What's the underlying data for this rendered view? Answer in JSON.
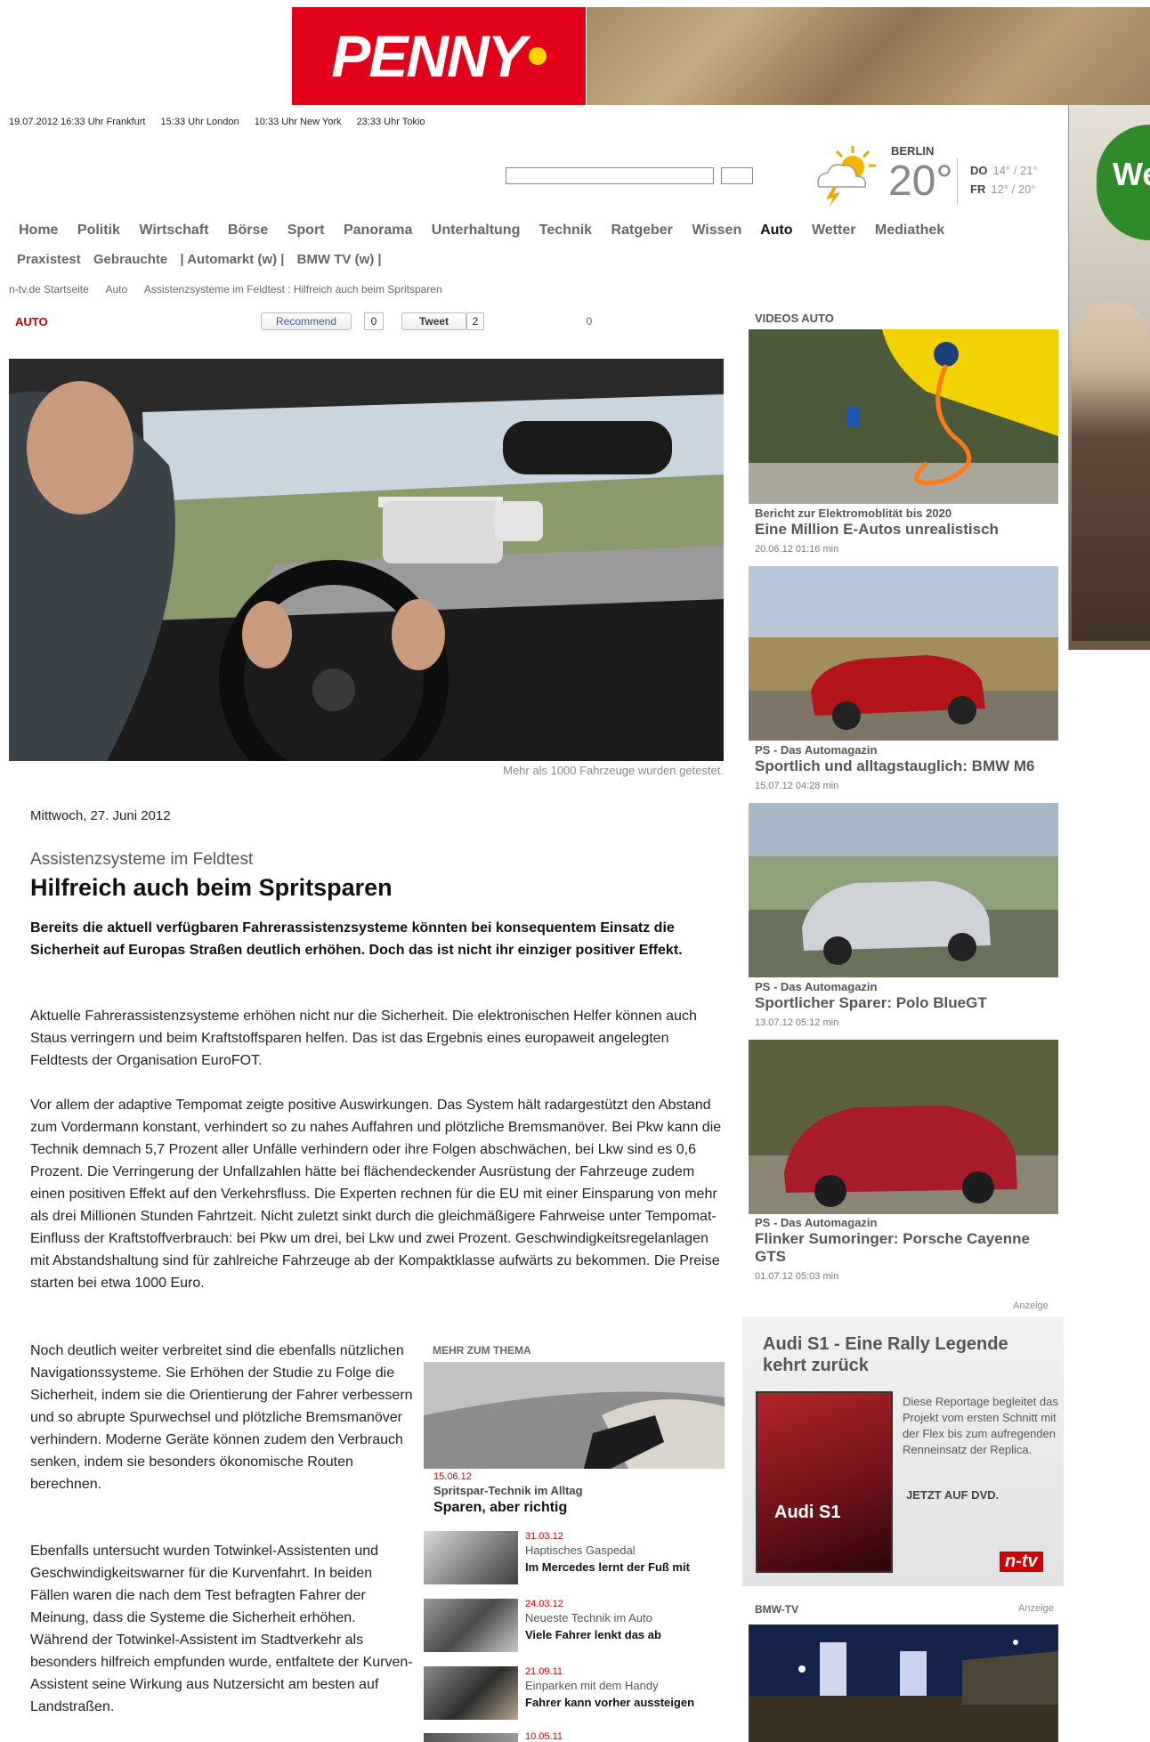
{
  "banner": {
    "logo_text": "PENNY"
  },
  "skyscraper": {
    "text": "We d"
  },
  "clock": [
    "19.07.2012 16:33 Uhr Frankfurt",
    "15:33 Uhr London",
    "10:33 Uhr New York",
    "23:33 Uhr Tokio"
  ],
  "weather": {
    "city": "BERLIN",
    "temp": "20°",
    "days": [
      {
        "day": "DO",
        "range": "14° / 21°"
      },
      {
        "day": "FR",
        "range": "12° / 20°"
      }
    ]
  },
  "nav": {
    "items": [
      "Home",
      "Politik",
      "Wirtschaft",
      "Börse",
      "Sport",
      "Panorama",
      "Unterhaltung",
      "Technik",
      "Ratgeber",
      "Wissen",
      "Auto",
      "Wetter",
      "Mediathek"
    ],
    "active": "Auto",
    "sub": [
      "Praxistest",
      "Gebrauchte",
      "| Automarkt (w) |",
      "BMW TV (w) |"
    ]
  },
  "breadcrumb": [
    "n-tv.de Startseite",
    "Auto",
    "Assistenzsysteme im Feldtest : Hilfreich auch beim Spritsparen"
  ],
  "section": "AUTO",
  "social": {
    "recommend": "Recommend",
    "recommend_count": "0",
    "tweet": "Tweet",
    "tweet_count": "2",
    "plus_count": "0"
  },
  "article": {
    "caption": "Mehr als 1000 Fahrzeuge wurden getestet.",
    "date": "Mittwoch, 27. Juni 2012",
    "kicker": "Assistenzsysteme im Feldtest",
    "headline": "Hilfreich auch beim Spritsparen",
    "lead": "Bereits die aktuell verfügbaren Fahrerassistenzsysteme könnten bei konsequentem Einsatz die Sicherheit auf Europas Straßen deutlich erhöhen. Doch das ist nicht ihr einziger positiver Effekt.",
    "paragraphs": [
      "Aktuelle Fahrerassistenzsysteme erhöhen nicht nur die Sicherheit. Die elektronischen Helfer können auch Staus verringern und beim Kraftstoffsparen helfen. Das ist das Ergebnis eines europaweit angelegten Feldtests der Organisation EuroFOT.",
      "Vor allem der adaptive Tempomat zeigte positive Auswirkungen. Das System hält radargestützt den Abstand zum Vordermann konstant, verhindert so zu nahes Auffahren und plötzliche Bremsmanöver. Bei Pkw kann die Technik demnach 5,7 Prozent aller Unfälle verhindern oder ihre Folgen abschwächen, bei Lkw sind es 0,6 Prozent. Die Verringerung der Unfallzahlen hätte bei flächendeckender Ausrüstung der Fahrzeuge zudem einen positiven Effekt auf den Verkehrsfluss. Die Experten rechnen für die EU mit einer Einsparung von mehr als drei Millionen Stunden Fahrtzeit. Nicht zuletzt sinkt durch die gleichmäßigere Fahrweise unter Tempomat-Einfluss der Kraftstoffverbrauch: bei Pkw um drei, bei Lkw und zwei Prozent. Geschwindigkeitsregelanlagen mit Abstandshaltung sind für zahlreiche Fahrzeuge ab der Kompaktklasse aufwärts zu bekommen. Die Preise starten bei etwa 1000 Euro.",
      "Noch deutlich weiter verbreitet sind die ebenfalls nützlichen Navigationssysteme. Sie Erhöhen der Studie zu Folge die Sicherheit, indem sie die Orientierung der Fahrer verbessern und so abrupte Spurwechsel und plötzliche Bremsmanöver verhindern. Moderne Geräte können zudem den Verbrauch senken, indem sie besonders ökonomische Routen berechnen.",
      "Ebenfalls untersucht wurden Totwinkel-Assistenten und Geschwindigkeitswarner für die Kurvenfahrt. In beiden Fällen waren die nach dem Test befragten Fahrer der Meinung, dass die Systeme die Sicherheit erhöhen. Während der Totwinkel-Assistent im Stadtverkehr als besonders hilfreich empfunden wurde, entfaltete der Kurven-Assistent seine Wirkung aus Nutzersicht am besten auf Landstraßen."
    ]
  },
  "mehr_zum_thema": {
    "title": "MEHR ZUM THEMA",
    "featured": {
      "date": "15.06.12",
      "kicker": "Spritspar-Technik im Alltag",
      "headline": "Sparen, aber richtig"
    },
    "items": [
      {
        "date": "31.03.12",
        "kicker": "Haptisches Gaspedal",
        "headline": "Im Mercedes lernt der Fuß mit"
      },
      {
        "date": "24.03.12",
        "kicker": "Neueste Technik im Auto",
        "headline": "Viele Fahrer lenkt das ab"
      },
      {
        "date": "21.09.11",
        "kicker": "Einparken mit dem Handy",
        "headline": "Fahrer kann vorher aussteigen"
      },
      {
        "date": "10.05.11",
        "kicker": "",
        "headline": ""
      }
    ]
  },
  "videos": {
    "title": "VIDEOS AUTO",
    "items": [
      {
        "kicker": "Bericht zur Elektromoblität bis 2020",
        "headline": "Eine Million E-Autos unrealistisch",
        "meta": "20.06.12  01:16 min"
      },
      {
        "kicker": "PS - Das Automagazin",
        "headline": "Sportlich und alltagstauglich: BMW M6",
        "meta": "15.07.12  04:28 min"
      },
      {
        "kicker": "PS - Das Automagazin",
        "headline": "Sportlicher Sparer: Polo BlueGT",
        "meta": "13.07.12  05:12 min"
      },
      {
        "kicker": "PS - Das Automagazin",
        "headline": "Flinker Sumoringer: Porsche Cayenne GTS",
        "meta": "01.07.12  05:03 min"
      }
    ]
  },
  "ad": {
    "label": "Anzeige",
    "title": "Audi S1 - Eine Rally Legende kehrt zurück",
    "text": "Diese Reportage begleitet das Projekt vom ersten Schnitt mit der Flex bis zum aufregenden Renneinsatz der Replica.",
    "dvd": "JETZT AUF DVD.",
    "cover_title": "Audi S1",
    "brand": "n-tv"
  },
  "bmw_tv": {
    "title": "BMW-TV",
    "label": "Anzeige"
  }
}
